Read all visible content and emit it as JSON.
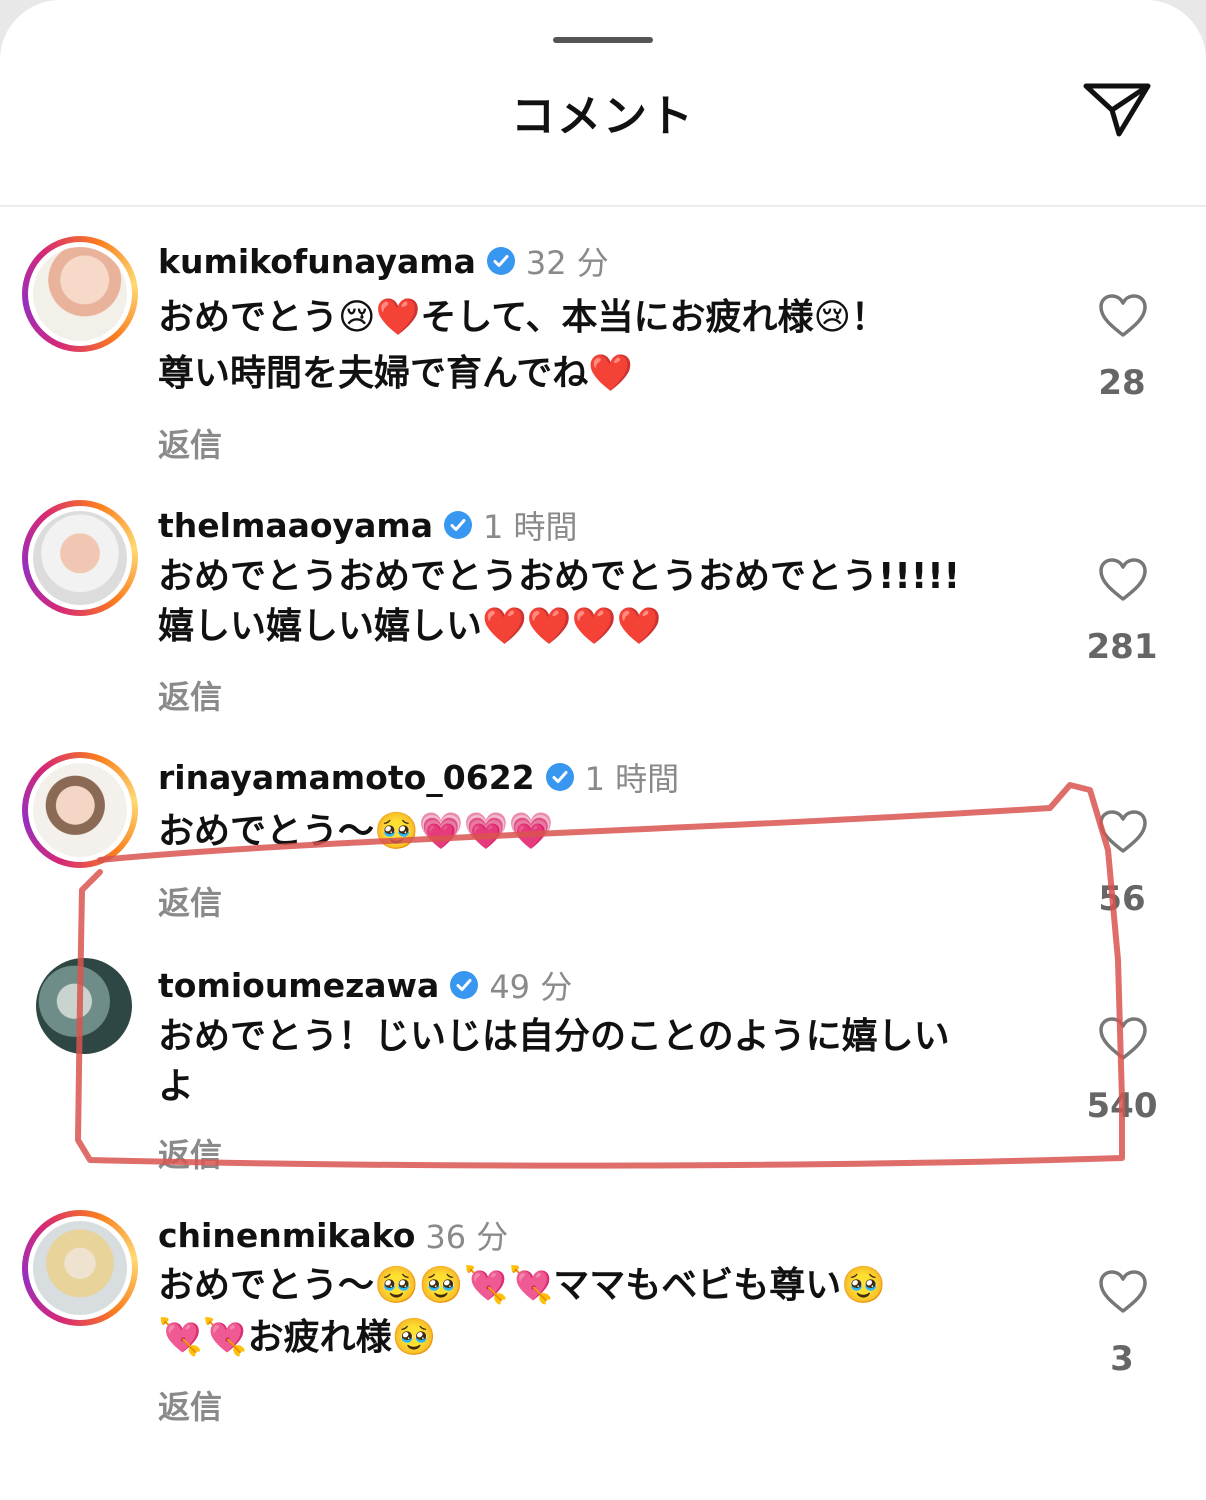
{
  "header": {
    "title": "コメント",
    "share_icon": "paper-plane-icon"
  },
  "colors": {
    "verified": "#3897f0",
    "highlight": "#d9534f"
  },
  "comments": [
    {
      "username": "kumikofunayama",
      "verified": true,
      "time": "32 分",
      "line1": "おめでとう😢❤️そして、本当にお疲れ様😢！",
      "line2": "尊い時間を夫婦で育んでね❤️",
      "reply": "返信",
      "likes": "28"
    },
    {
      "username": "thelmaaoyama",
      "verified": true,
      "time": "1 時間",
      "line1": "おめでとうおめでとうおめでとうおめでとう!!!!!",
      "line2": "嬉しい嬉しい嬉しい❤️❤️❤️❤️",
      "reply": "返信",
      "likes": "281"
    },
    {
      "username": "rinayamamoto_0622",
      "verified": true,
      "time": "1 時間",
      "line1": "おめでとう〜🥹💗💗💗",
      "line2": "",
      "reply": "返信",
      "likes": "56"
    },
    {
      "username": "tomioumezawa",
      "verified": true,
      "time": "49 分",
      "line1": "おめでとう！じいじは自分のことのように嬉しい",
      "line2": "よ",
      "reply": "返信",
      "likes": "540"
    },
    {
      "username": "chinenmikako",
      "verified": false,
      "time": "36 分",
      "line1": "おめでとう〜🥹🥹💘💘ママもベビも尊い🥹",
      "line2": "💘💘お疲れ様🥹",
      "reply": "返信",
      "likes": "3"
    }
  ]
}
